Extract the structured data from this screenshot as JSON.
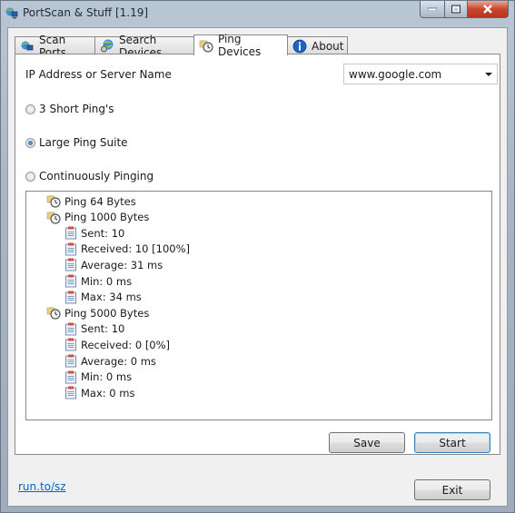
{
  "window": {
    "title": "PortScan & Stuff [1.19]",
    "icon": "network-computer-icon",
    "controls": {
      "minimize": "minimize-icon",
      "maximize": "maximize-icon",
      "close": "close-icon"
    }
  },
  "tabs": [
    {
      "label": "Scan Ports",
      "icon": "network-computer-icon",
      "active": false
    },
    {
      "label": "Search Devices",
      "icon": "globe-search-icon",
      "active": false
    },
    {
      "label": "Ping Devices",
      "icon": "stopwatch-icon",
      "active": true
    },
    {
      "label": "About",
      "icon": "info-icon",
      "active": false
    }
  ],
  "ping": {
    "host_label": "IP Address or Server Name",
    "host_value": "www.google.com",
    "modes": [
      {
        "label": "3 Short Ping's",
        "selected": false
      },
      {
        "label": "Large Ping Suite",
        "selected": true
      },
      {
        "label": "Continuously Pinging",
        "selected": false
      }
    ],
    "results": [
      {
        "label": "Ping 64 Bytes",
        "children": []
      },
      {
        "label": "Ping 1000 Bytes",
        "children": [
          "Sent: 10",
          "Received: 10 [100%]",
          "Average: 31 ms",
          "Min: 0 ms",
          "Max: 34 ms"
        ]
      },
      {
        "label": "Ping 5000 Bytes",
        "children": [
          "Sent: 10",
          "Received: 0 [0%]",
          "Average: 0 ms",
          "Min: 0 ms",
          "Max: 0 ms"
        ]
      }
    ],
    "save_label": "Save",
    "start_label": "Start"
  },
  "footer": {
    "link_text": "run.to/sz",
    "exit_label": "Exit"
  }
}
